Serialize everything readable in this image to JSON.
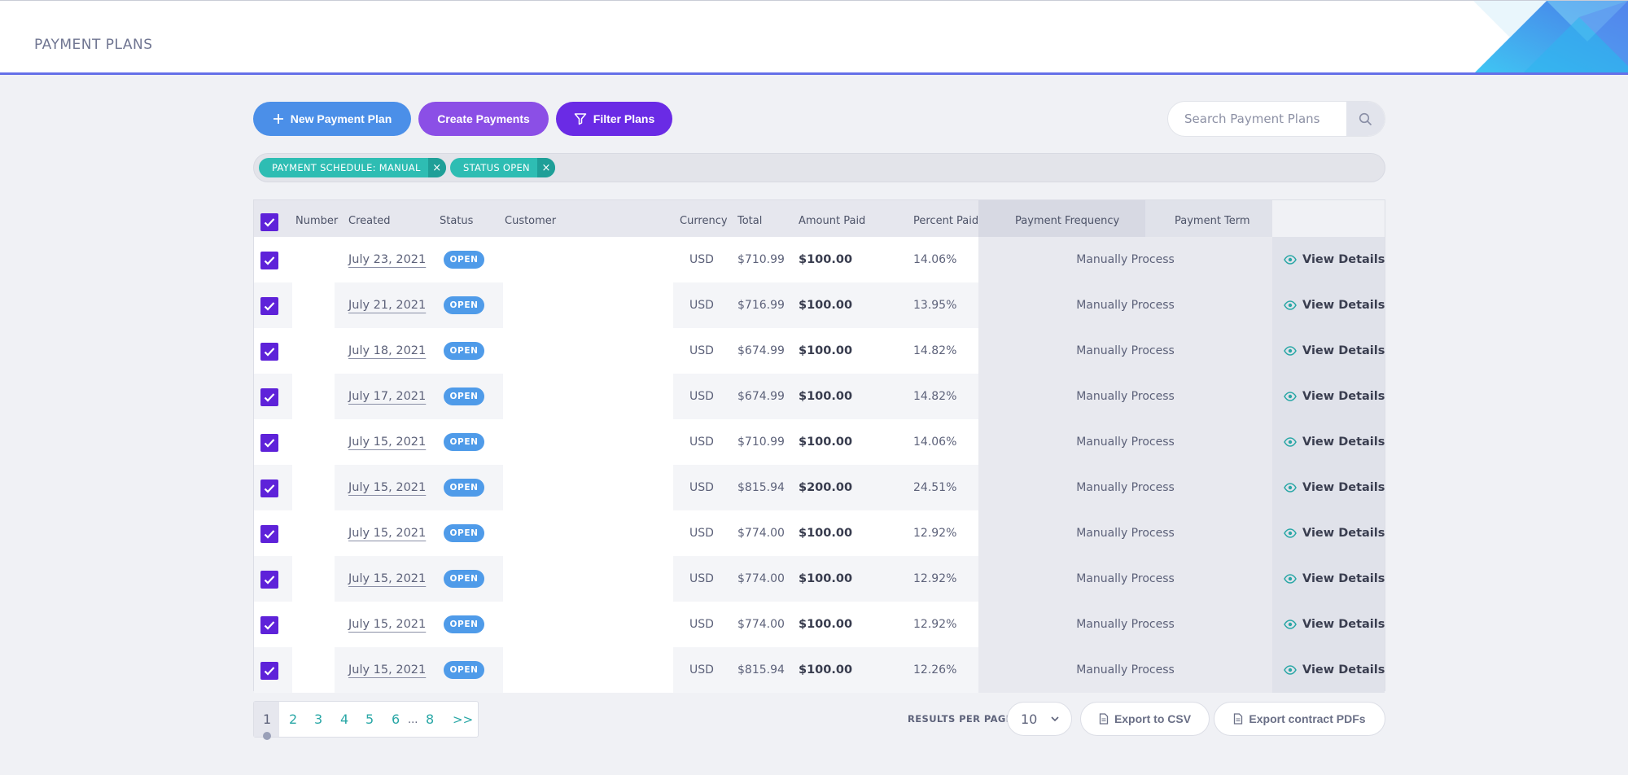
{
  "header": {
    "title": "PAYMENT PLANS"
  },
  "toolbar": {
    "new_plan_label": "New Payment Plan",
    "create_payments_label": "Create Payments",
    "filter_plans_label": "Filter Plans"
  },
  "search": {
    "placeholder": "Search Payment Plans",
    "value": ""
  },
  "filters": [
    {
      "label": "PAYMENT SCHEDULE: MANUAL",
      "remove": "×"
    },
    {
      "label": "STATUS OPEN",
      "remove": "×"
    }
  ],
  "table": {
    "columns": [
      "Number",
      "Created",
      "Status",
      "Customer",
      "Currency",
      "Total",
      "Amount Paid",
      "Percent Paid",
      "Payment Frequency",
      "Payment Term"
    ],
    "rows": [
      {
        "number": "",
        "created": "July 23, 2021",
        "status": "OPEN",
        "customer": "",
        "currency": "USD",
        "total": "$710.99",
        "amount_paid": "$100.00",
        "percent_paid": "14.06%",
        "frequency": "Manually Process",
        "term": "",
        "action": "View Details"
      },
      {
        "number": "",
        "created": "July 21, 2021",
        "status": "OPEN",
        "customer": "",
        "currency": "USD",
        "total": "$716.99",
        "amount_paid": "$100.00",
        "percent_paid": "13.95%",
        "frequency": "Manually Process",
        "term": "",
        "action": "View Details"
      },
      {
        "number": "",
        "created": "July 18, 2021",
        "status": "OPEN",
        "customer": "",
        "currency": "USD",
        "total": "$674.99",
        "amount_paid": "$100.00",
        "percent_paid": "14.82%",
        "frequency": "Manually Process",
        "term": "",
        "action": "View Details"
      },
      {
        "number": "",
        "created": "July 17, 2021",
        "status": "OPEN",
        "customer": "",
        "currency": "USD",
        "total": "$674.99",
        "amount_paid": "$100.00",
        "percent_paid": "14.82%",
        "frequency": "Manually Process",
        "term": "",
        "action": "View Details"
      },
      {
        "number": "",
        "created": "July 15, 2021",
        "status": "OPEN",
        "customer": "",
        "currency": "USD",
        "total": "$710.99",
        "amount_paid": "$100.00",
        "percent_paid": "14.06%",
        "frequency": "Manually Process",
        "term": "",
        "action": "View Details"
      },
      {
        "number": "",
        "created": "July 15, 2021",
        "status": "OPEN",
        "customer": "",
        "currency": "USD",
        "total": "$815.94",
        "amount_paid": "$200.00",
        "percent_paid": "24.51%",
        "frequency": "Manually Process",
        "term": "",
        "action": "View Details"
      },
      {
        "number": "",
        "created": "July 15, 2021",
        "status": "OPEN",
        "customer": "",
        "currency": "USD",
        "total": "$774.00",
        "amount_paid": "$100.00",
        "percent_paid": "12.92%",
        "frequency": "Manually Process",
        "term": "",
        "action": "View Details"
      },
      {
        "number": "",
        "created": "July 15, 2021",
        "status": "OPEN",
        "customer": "",
        "currency": "USD",
        "total": "$774.00",
        "amount_paid": "$100.00",
        "percent_paid": "12.92%",
        "frequency": "Manually Process",
        "term": "",
        "action": "View Details"
      },
      {
        "number": "",
        "created": "July 15, 2021",
        "status": "OPEN",
        "customer": "",
        "currency": "USD",
        "total": "$774.00",
        "amount_paid": "$100.00",
        "percent_paid": "12.92%",
        "frequency": "Manually Process",
        "term": "",
        "action": "View Details"
      },
      {
        "number": "",
        "created": "July 15, 2021",
        "status": "OPEN",
        "customer": "",
        "currency": "USD",
        "total": "$815.94",
        "amount_paid": "$100.00",
        "percent_paid": "12.26%",
        "frequency": "Manually Process",
        "term": "",
        "action": "View Details"
      }
    ]
  },
  "pagination": {
    "pages": [
      "1",
      "2",
      "3",
      "4",
      "5",
      "6",
      "...",
      "8",
      ">>"
    ],
    "current": "1"
  },
  "footer": {
    "results_per_page_label": "RESULTS PER PAGE",
    "results_per_page_value": "10",
    "export_csv_label": "Export to CSV",
    "export_pdf_label": "Export contract PDFs"
  },
  "colors": {
    "accent_blue": "#4b8fe8",
    "accent_purple": "#8b4fe6",
    "accent_violet": "#6a2be5",
    "checkbox": "#5e22d9",
    "tag_teal": "#2ebdb3",
    "status_badge": "#4f9be9"
  },
  "icons": {
    "new_plan": "plus-icon",
    "filter": "funnel-icon",
    "search": "search-icon",
    "view": "eye-icon",
    "export": "document-icon",
    "dropdown": "chevron-down-icon"
  }
}
